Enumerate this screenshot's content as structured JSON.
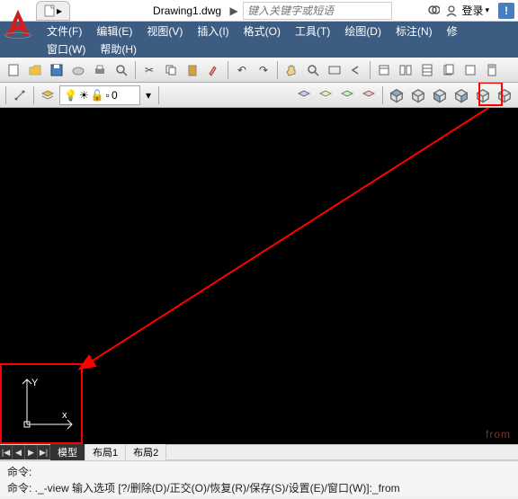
{
  "titlebar": {
    "filename": "Drawing1.dwg",
    "search_placeholder": "键入关键字或短语",
    "login": "登录"
  },
  "menu": {
    "row1": [
      "文件(F)",
      "编辑(E)",
      "视图(V)",
      "插入(I)",
      "格式(O)",
      "工具(T)",
      "绘图(D)",
      "标注(N)",
      "修"
    ],
    "row2": [
      "窗口(W)",
      "帮助(H)"
    ]
  },
  "layer": {
    "zero": "0"
  },
  "tabs": {
    "nav": [
      "|◀",
      "◀",
      "▶",
      "▶|"
    ],
    "items": [
      "模型",
      "布局1",
      "布局2"
    ]
  },
  "ucs": {
    "x": "x",
    "y": "Y"
  },
  "command": {
    "line1": "命令:",
    "line2": "命令: ._-view 输入选项 [?/删除(D)/正交(O)/恢复(R)/保存(S)/设置(E)/窗口(W)]:_from"
  },
  "watermark": "from"
}
